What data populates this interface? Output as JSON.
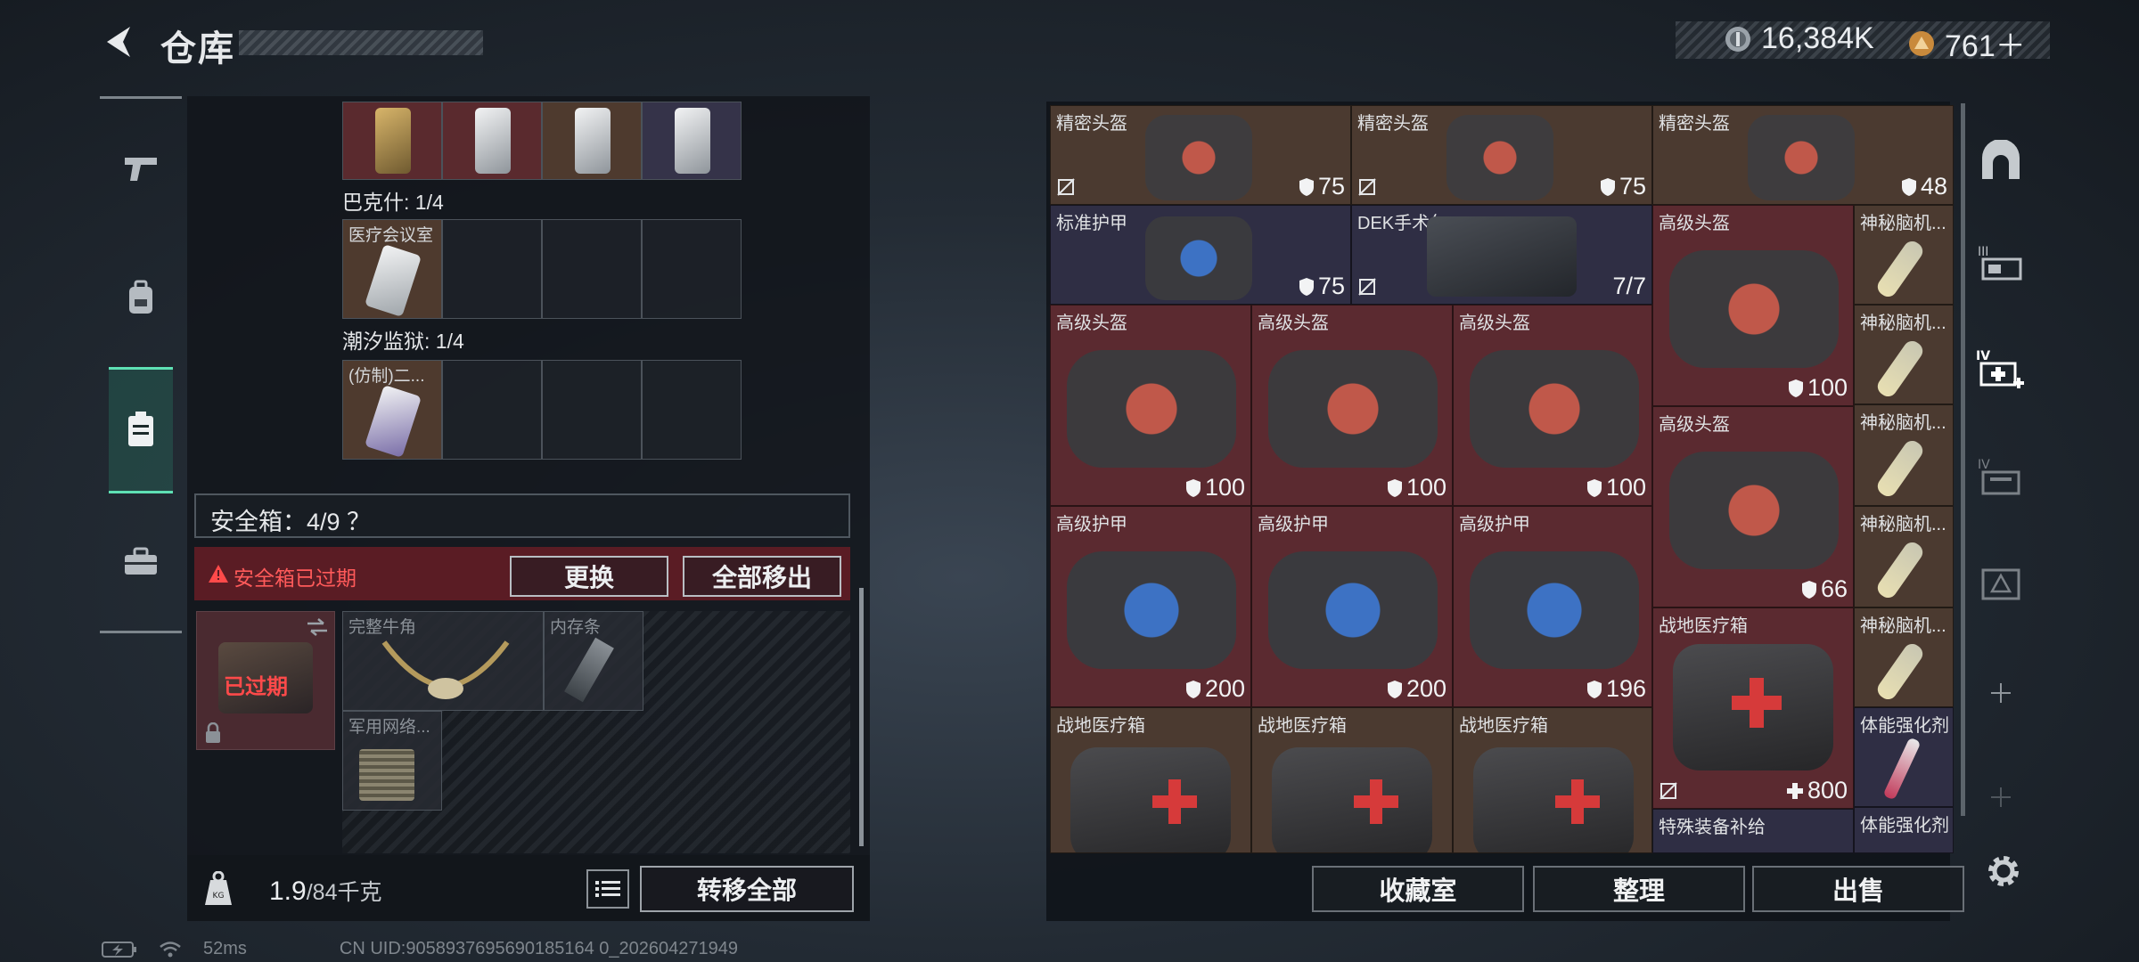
{
  "header": {
    "title": "仓库"
  },
  "currency": {
    "coins": "16,384K",
    "points": "761＋"
  },
  "collections": [
    {
      "label": "巴克什: 1/4"
    },
    {
      "label": "医疗会议室"
    },
    {
      "label": "潮汐监狱: 1/4"
    },
    {
      "label": "(仿制)二..."
    }
  ],
  "safe_box": {
    "label": "安全箱：4/9 ？",
    "expired_text": "安全箱已过期",
    "replace_btn": "更换",
    "move_all_out_btn": "全部移出",
    "box_expired_label": "已过期",
    "items": [
      {
        "name": "完整牛角"
      },
      {
        "name": "内存条"
      },
      {
        "name": "军用网络..."
      }
    ]
  },
  "weight": {
    "current": "1.9",
    "max": "/84千克"
  },
  "transfer_all_btn": "转移全部",
  "inventory": {
    "items": [
      {
        "name": "精密头盔",
        "value": "75",
        "icon": "shield-icon"
      },
      {
        "name": "精密头盔",
        "value": "75",
        "icon": "shield-icon"
      },
      {
        "name": "精密头盔",
        "value": "48",
        "icon": "shield-icon"
      },
      {
        "name": "标准护甲",
        "value": "75",
        "icon": "shield-icon"
      },
      {
        "name": "DEK手术包",
        "value": "7/7",
        "icon": "none"
      },
      {
        "name": "高级头盔",
        "value": "100",
        "icon": "shield-icon"
      },
      {
        "name": "神秘脑机..."
      },
      {
        "name": "高级头盔",
        "value": "100",
        "icon": "shield-icon"
      },
      {
        "name": "高级头盔",
        "value": "100",
        "icon": "shield-icon"
      },
      {
        "name": "高级头盔",
        "value": "100",
        "icon": "shield-icon"
      },
      {
        "name": "神秘脑机..."
      },
      {
        "name": "高级头盔",
        "value": "66",
        "icon": "shield-icon"
      },
      {
        "name": "神秘脑机..."
      },
      {
        "name": "高级护甲",
        "value": "200",
        "icon": "shield-icon"
      },
      {
        "name": "高级护甲",
        "value": "200",
        "icon": "shield-icon"
      },
      {
        "name": "高级护甲",
        "value": "196",
        "icon": "shield-icon"
      },
      {
        "name": "神秘脑机..."
      },
      {
        "name": "战地医疗箱",
        "value": "800",
        "icon": "plus-icon"
      },
      {
        "name": "神秘脑机..."
      },
      {
        "name": "战地医疗箱"
      },
      {
        "name": "战地医疗箱"
      },
      {
        "name": "战地医疗箱"
      },
      {
        "name": "体能强化剂"
      },
      {
        "name": "特殊装备补给"
      },
      {
        "name": "体能强化剂"
      }
    ]
  },
  "bottom_buttons": {
    "collection": "收藏室",
    "organize": "整理",
    "sell": "出售"
  },
  "footer": {
    "ping": "52ms",
    "uid": "CN UID:9058937695690185164 0_202604271949"
  },
  "colors": {
    "accent": "#5ee0b4",
    "expired": "#ff4a4a",
    "panel": "#12161b"
  }
}
